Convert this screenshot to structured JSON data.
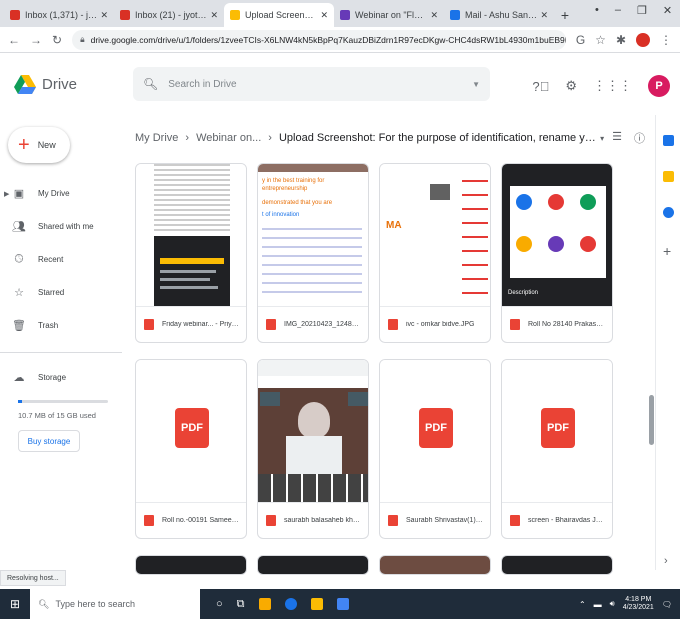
{
  "browser": {
    "tabs": [
      {
        "title": "Inbox (1,371) - jyotiyogeshy",
        "color": "#d93025",
        "active": false
      },
      {
        "title": "Inbox (21) - jyotiyogeshy@gmai",
        "color": "#d93025",
        "active": false
      },
      {
        "title": "Upload Screenshot: For the p",
        "color": "#fbbc04",
        "active": true
      },
      {
        "title": "Webinar on \"Flow your PhD",
        "color": "#673ab7",
        "active": false
      },
      {
        "title": "Mail - Ashu Sankhe - Outlook",
        "color": "#1a73e8",
        "active": false
      }
    ],
    "newtab": "+",
    "window_controls": [
      "•",
      "–",
      "❐",
      "✕"
    ],
    "url": "drive.google.com/drive/u/1/folders/1zveeTCIs-X6LNW4kN5kBpPq7KauzDBiZdrn1R97ecDKgw-CHC4dsRW1bL4930m1buEB9F"
  },
  "drive": {
    "logo_text": "Drive",
    "search_placeholder": "Search in Drive",
    "new_label": "New",
    "nav": [
      {
        "label": "My Drive",
        "icon": "drive-icon"
      },
      {
        "label": "Shared with me",
        "icon": "people-icon"
      },
      {
        "label": "Recent",
        "icon": "clock-icon"
      },
      {
        "label": "Starred",
        "icon": "star-icon"
      },
      {
        "label": "Trash",
        "icon": "trash-icon"
      }
    ],
    "storage_label": "Storage",
    "storage_used": "10.7 MB of 15 GB used",
    "storage_fraction": 0.04,
    "buy_storage": "Buy storage",
    "avatar_letter": "P",
    "breadcrumb": {
      "root": "My Drive",
      "middle": "Webinar on...",
      "current": "Upload Screenshot: For the purpose of identification, rename your screenshot..."
    },
    "files": [
      {
        "name": "Friday webinar... - Priyank...",
        "type": "image"
      },
      {
        "name": "IMG_20210423_124828 - ...",
        "type": "image"
      },
      {
        "name": "ivc - omkar bidve.JPG",
        "type": "image"
      },
      {
        "name": "Roll No 28140 Prakash M...",
        "type": "image"
      },
      {
        "name": "Roll no.-00191 Sameer da...",
        "type": "pdf"
      },
      {
        "name": "saurabh balasaheb khend...",
        "type": "image"
      },
      {
        "name": "Saurabh Shrivastav(1) - S...",
        "type": "pdf"
      },
      {
        "name": "screen - Bhairavdas Jadha...",
        "type": "pdf"
      }
    ],
    "pdf_label": "PDF",
    "thumb_text": {
      "t2_line1": "y in the best training for entrepreneurship",
      "t2_line2": "demonstrated that you are",
      "t2_line3": "t of innovation",
      "t3_text": "MA",
      "t4_caption": "Description"
    }
  },
  "status_text": "Resolving host...",
  "taskbar": {
    "search_placeholder": "Type here to search",
    "time": "4:18 PM",
    "date": "4/23/2021"
  }
}
